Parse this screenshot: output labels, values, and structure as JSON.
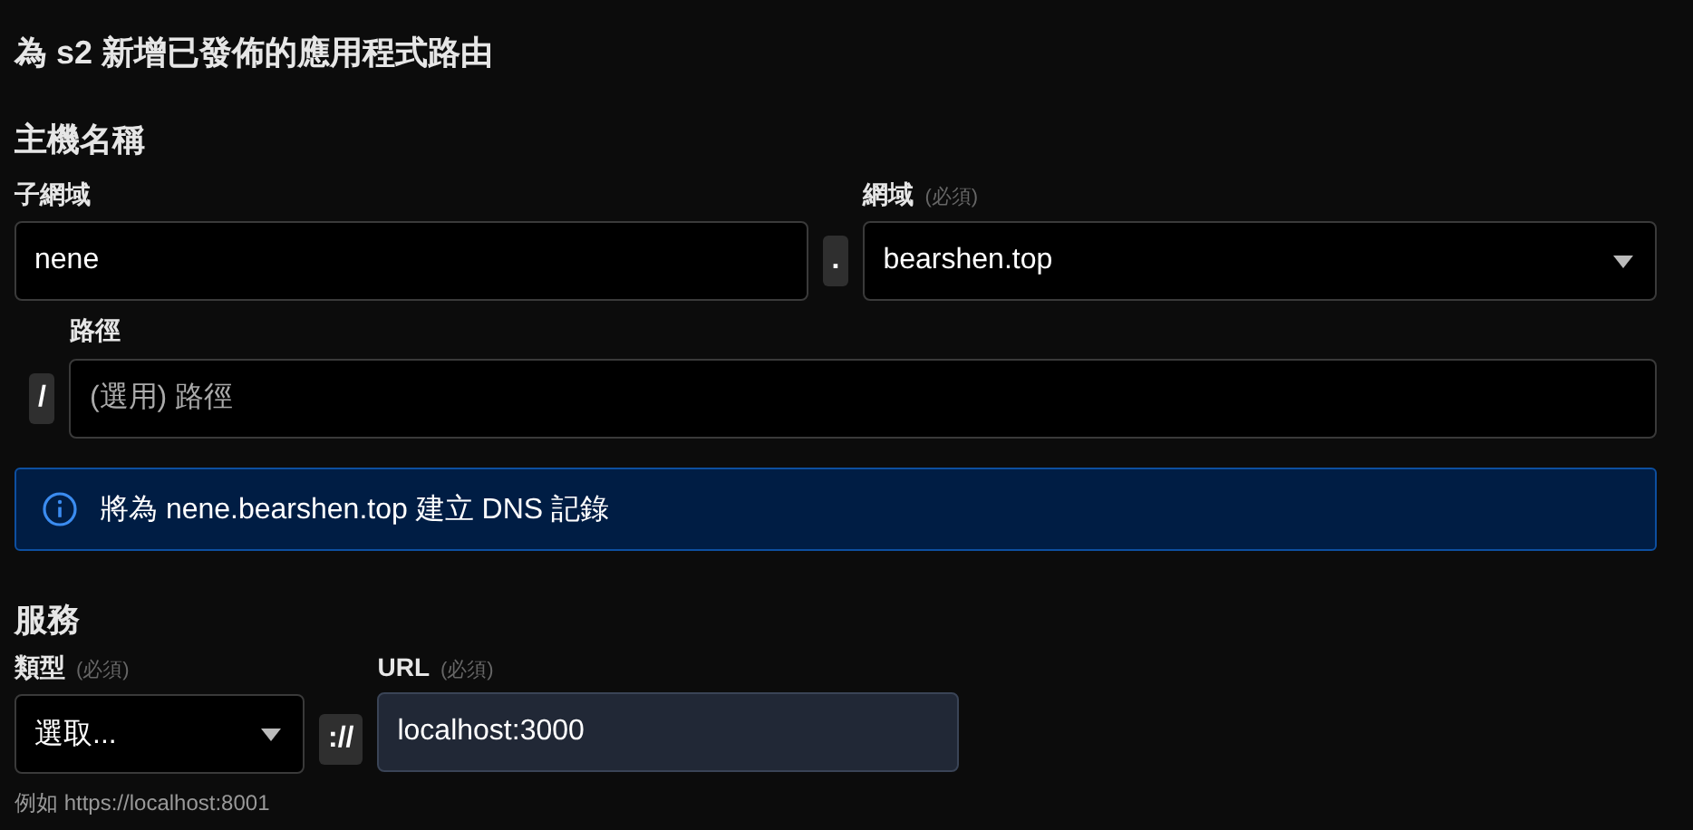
{
  "title": "為 s2 新增已發佈的應用程式路由",
  "hostname": {
    "heading": "主機名稱",
    "subdomain": {
      "label": "子網域",
      "value": "nene"
    },
    "separator": ".",
    "domain": {
      "label": "網域",
      "required_tag": "(必須)",
      "value": "bearshen.top"
    },
    "path": {
      "label": "路徑",
      "separator": "/",
      "placeholder": "(選用) 路徑"
    }
  },
  "info": {
    "text": "將為 nene.bearshen.top 建立 DNS 記錄"
  },
  "service": {
    "heading": "服務",
    "type": {
      "label": "類型",
      "required_tag": "(必須)",
      "value": "選取...",
      "hint": "例如 https://localhost:8001"
    },
    "separator": "://",
    "url": {
      "label": "URL",
      "required_tag": "(必須)",
      "value": "localhost:3000"
    }
  }
}
